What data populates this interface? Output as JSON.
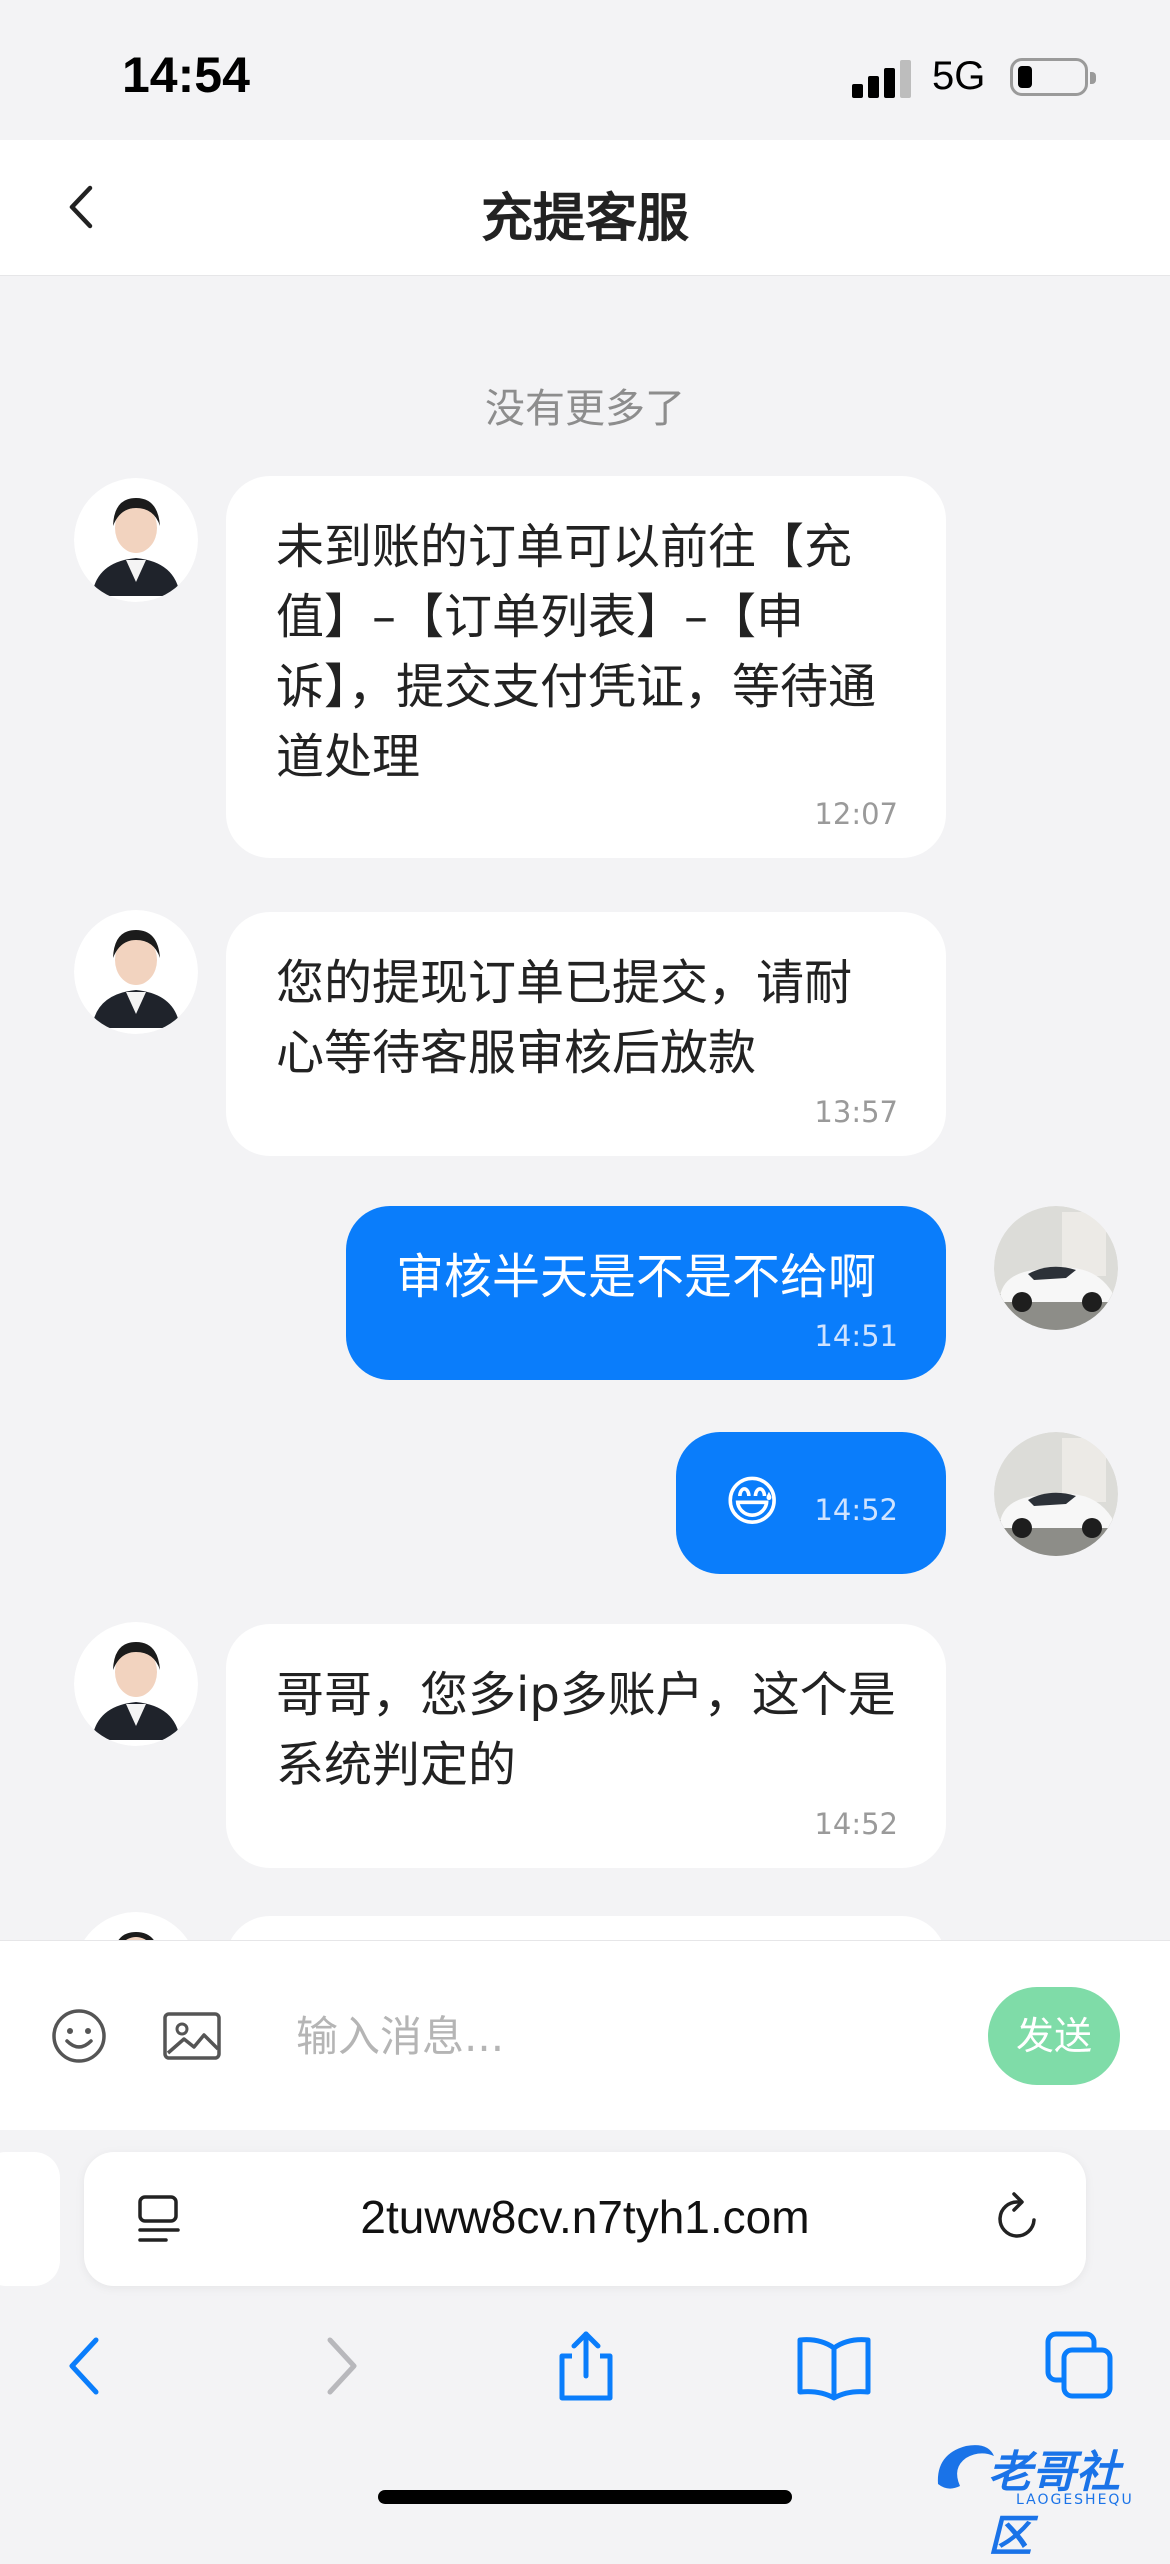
{
  "status_bar": {
    "time": "14:54",
    "network": "5G"
  },
  "nav": {
    "title": "充提客服"
  },
  "chat": {
    "no_more": "没有更多了",
    "messages": [
      {
        "side": "in",
        "text": "未到账的订单可以前往【充值】–【订单列表】–【申诉】，提交支付凭证，等待通道处理",
        "time": "12:07"
      },
      {
        "side": "in",
        "text": "您的提现订单已提交，请耐心等待客服审核后放款",
        "time": "13:57"
      },
      {
        "side": "out",
        "text": "审核半天是不是不给啊",
        "time": "14:51"
      },
      {
        "side": "out",
        "text": "😅",
        "time": "14:52"
      },
      {
        "side": "in",
        "text": "哥哥，您多ip多账户，这个是系统判定的",
        "time": "14:52"
      }
    ]
  },
  "composer": {
    "placeholder": "输入消息...",
    "send_label": "发送"
  },
  "browser": {
    "url": "2tuww8cv.n7tyh1.com"
  },
  "watermark": {
    "text": "老哥社区",
    "sub": "LAOGESHEQU"
  },
  "colors": {
    "outgoing_bubble": "#0a7dfb",
    "send_button": "#7fdca8",
    "background": "#f3f3f5"
  }
}
